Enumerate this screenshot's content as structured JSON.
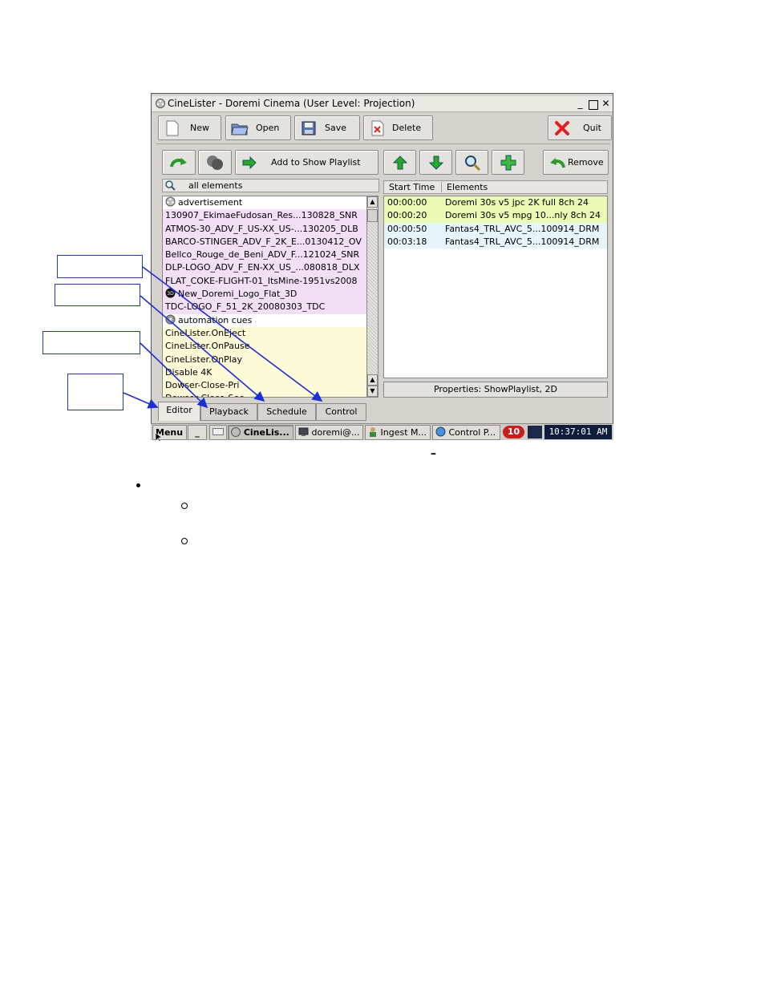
{
  "window": {
    "title": "CineLister - Doremi Cinema (User Level: Projection)",
    "controls": {
      "minimize": "_",
      "maximize": "□",
      "close": "✕"
    }
  },
  "toolbar": {
    "new": "New",
    "open": "Open",
    "save": "Save",
    "delete": "Delete",
    "quit": "Quit"
  },
  "actions": {
    "add_to_show": "Add to Show Playlist",
    "remove": "Remove"
  },
  "library": {
    "header": "all elements",
    "items": [
      {
        "text": "advertisement",
        "style": "white",
        "icon": "film-reel-icon"
      },
      {
        "text": "130907_EkimaeFudosan_Res...130828_SNR",
        "style": "pink"
      },
      {
        "text": "ATMOS-30_ADV_F_US-XX_US-...130205_DLB",
        "style": "pink"
      },
      {
        "text": "BARCO-STINGER_ADV_F_2K_E...0130412_OV",
        "style": "pink"
      },
      {
        "text": "Bellco_Rouge_de_Beni_ADV_F...121024_SNR",
        "style": "pink"
      },
      {
        "text": "DLP-LOGO_ADV_F_EN-XX_US_...080818_DLX",
        "style": "pink"
      },
      {
        "text": "FLAT_COKE-FLIGHT-01_ItsMine-1951vs2008",
        "style": "pink"
      },
      {
        "text": "New_Doremi_Logo_Flat_3D",
        "style": "pink",
        "icon": "3d-badge-icon"
      },
      {
        "text": "TDC-LOGO_F_51_2K_20080303_TDC",
        "style": "pink"
      },
      {
        "text": "automation cues",
        "style": "white",
        "icon": "gear-icon"
      },
      {
        "text": "CineLister.OnEject",
        "style": "yellow"
      },
      {
        "text": "CineLister.OnPause",
        "style": "yellow"
      },
      {
        "text": "CineLister.OnPlay",
        "style": "yellow"
      },
      {
        "text": "Disable 4K",
        "style": "yellow"
      },
      {
        "text": "Dowser-Close-Pri",
        "style": "yellow"
      },
      {
        "text": "Dowser-Close-Sec",
        "style": "yellow"
      }
    ]
  },
  "playlist": {
    "col_start": "Start Time",
    "col_elements": "Elements",
    "rows": [
      {
        "time": "00:00:00",
        "element": "Doremi 30s v5 jpc 2K full 8ch 24",
        "style": "green"
      },
      {
        "time": "00:00:20",
        "element": "Doremi 30s v5 mpg 10...nly 8ch 24",
        "style": "green"
      },
      {
        "time": "00:00:50",
        "element": "Fantas4_TRL_AVC_5...100914_DRM",
        "style": "blue"
      },
      {
        "time": "00:03:18",
        "element": "Fantas4_TRL_AVC_5...100914_DRM",
        "style": "blue"
      }
    ],
    "properties": "Properties: ShowPlaylist, 2D"
  },
  "tabs": [
    "Editor",
    "Playback",
    "Schedule",
    "Control"
  ],
  "taskbar": {
    "menu": "Menu",
    "min": "_",
    "tasks": [
      "CineLis...",
      "doremi@...",
      "Ingest M...",
      "Control P..."
    ],
    "badge": "10",
    "clock": "10:37:01 AM"
  },
  "page": {
    "dash": "–"
  },
  "colors": {
    "pink_row": "#f2dff5",
    "yellow_row": "#fdfad8",
    "green_row": "#eaf9b4",
    "blue_row": "#e6f4fb",
    "arrow": "#1a2fd8"
  }
}
